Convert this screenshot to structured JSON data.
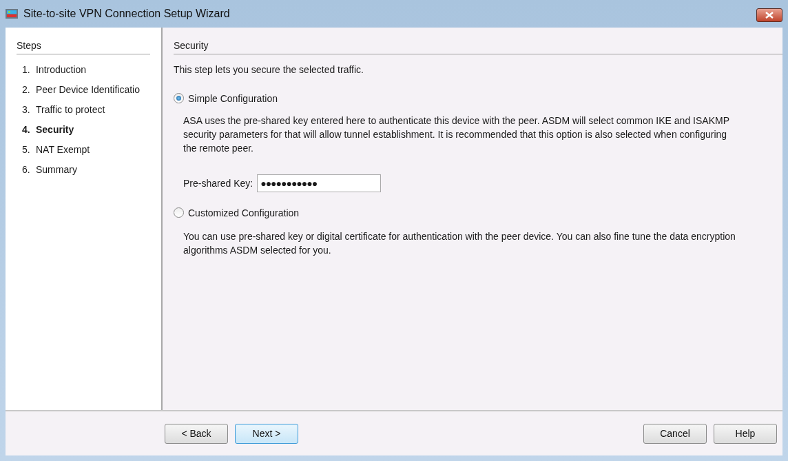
{
  "window": {
    "title": "Site-to-site VPN Connection Setup Wizard"
  },
  "steps": {
    "heading": "Steps",
    "items": [
      {
        "number": "1.",
        "label": "Introduction",
        "selected": false
      },
      {
        "number": "2.",
        "label": "Peer Device Identificatio",
        "selected": false
      },
      {
        "number": "3.",
        "label": "Traffic to protect",
        "selected": false
      },
      {
        "number": "4.",
        "label": "Security",
        "selected": true
      },
      {
        "number": "5.",
        "label": "NAT Exempt",
        "selected": false
      },
      {
        "number": "6.",
        "label": "Summary",
        "selected": false
      }
    ]
  },
  "page": {
    "heading": "Security",
    "intro": "This step lets you secure the selected traffic.",
    "options": [
      {
        "label": "Simple Configuration",
        "selected": true,
        "description": "ASA uses the pre-shared key entered here to authenticate this device with the peer. ASDM will select common IKE and ISAKMP security parameters for that will allow tunnel establishment. It is recommended that this option is also selected when configuring the remote peer.",
        "field": {
          "label": "Pre-shared Key:",
          "value": "●●●●●●●●●●●"
        }
      },
      {
        "label": "Customized Configuration",
        "selected": false,
        "description": "You can use pre-shared key or digital certificate for authentication with the peer device. You can also fine tune the data encryption algorithms ASDM selected for you."
      }
    ]
  },
  "buttons_left": [
    {
      "label": "< Back",
      "focused": false
    },
    {
      "label": "Next >",
      "focused": true
    }
  ],
  "buttons_right": [
    {
      "label": "Cancel",
      "focused": false
    },
    {
      "label": "Help",
      "focused": false
    }
  ]
}
